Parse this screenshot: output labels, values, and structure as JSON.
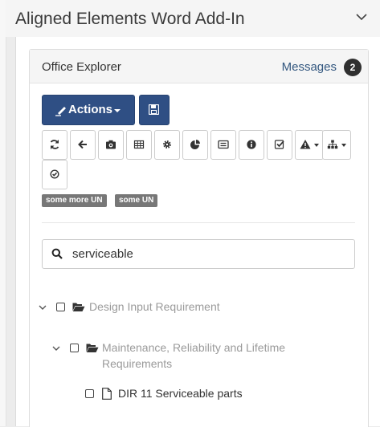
{
  "header": {
    "title": "Aligned Elements Word Add-In"
  },
  "panel": {
    "title": "Office Explorer",
    "messages_label": "Messages",
    "messages_count": "2"
  },
  "toolbar": {
    "actions_label": "Actions",
    "buttons": [
      "refresh-icon",
      "arrow-left-icon",
      "camera-icon",
      "table-icon",
      "gear-icon",
      "pie-chart-icon",
      "list-alt-icon",
      "info-icon",
      "check-square-icon",
      "warning-icon",
      "sitemap-icon",
      "check-circle-icon"
    ]
  },
  "labels": [
    "some more UN",
    "some UN"
  ],
  "search": {
    "value": "serviceable"
  },
  "tree": {
    "node1": "Design Input Requirement",
    "node2_line1": "Maintenance, Reliability and Lifetime",
    "node2_line2": "Requirements",
    "node3": "DIR 11 Serviceable parts"
  },
  "colors": {
    "primary": "#2f4f84",
    "badge": "#2f2f2f",
    "label": "#777777",
    "link": "#33577f"
  }
}
